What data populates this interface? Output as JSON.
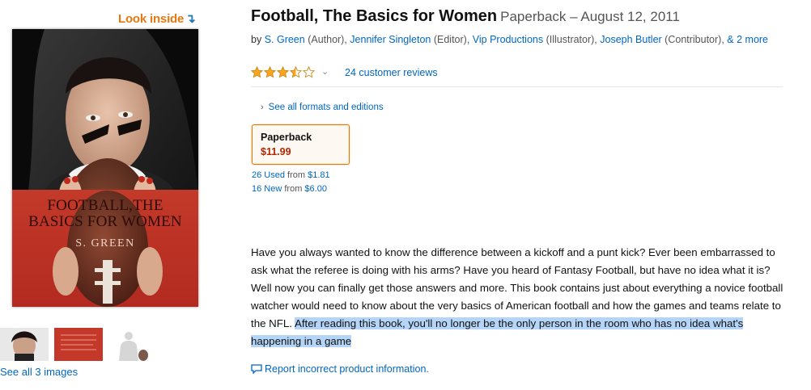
{
  "look_inside": {
    "label": "Look inside",
    "arrow": "↴"
  },
  "cover": {
    "title_line1": "FOOTBALL,THE",
    "title_line2": "BASICS FOR WOMEN",
    "author": "S. GREEN"
  },
  "thumbnails": [
    "cover-thumbnail",
    "back-cover-thumbnail",
    "interior-thumbnail"
  ],
  "see_all_images": "See all 3 images",
  "product": {
    "title": "Football, The Basics for Women",
    "format_date": "Paperback – August 12, 2011"
  },
  "byline": {
    "by": "by ",
    "contributors": [
      {
        "name": "S. Green",
        "role": " (Author), "
      },
      {
        "name": "Jennifer Singleton",
        "role": " (Editor), "
      },
      {
        "name": "Vip Productions",
        "role": " (Illustrator), "
      },
      {
        "name": "Joseph Butler",
        "role": " (Contributor), "
      }
    ],
    "more": "& 2 more"
  },
  "rating": {
    "stars": 3.5,
    "chevron": "⌄",
    "reviews_text": "24 customer reviews"
  },
  "formats": {
    "see_all_label": "See all formats and editions",
    "selected": {
      "label": "Paperback",
      "price": "$11.99"
    }
  },
  "offers": {
    "used_link": "26 Used",
    "used_from": " from ",
    "used_price": "$1.81",
    "new_link": "16 New",
    "new_from": " from ",
    "new_price": "$6.00"
  },
  "description": {
    "text": "Have you always wanted to know the difference between a kickoff and a punt kick? Ever been embarrassed to ask what the referee is doing with his arms? Have you heard of Fantasy Football, but have no idea what it is? Well now you can finally get those answers and more. This book contains just about everything a novice football watcher would need to know about the very basics of American football and how the games and teams relate to the NFL. ",
    "highlighted": "After reading this book, you'll no longer be the only person in the room who has no idea what's happening in a game"
  },
  "report_link": "Report incorrect product information.",
  "colors": {
    "link": "#0066c0",
    "look_inside": "#e47911",
    "price": "#b12704",
    "star": "#ffa41c",
    "selection_highlight": "#b5d5f8"
  }
}
